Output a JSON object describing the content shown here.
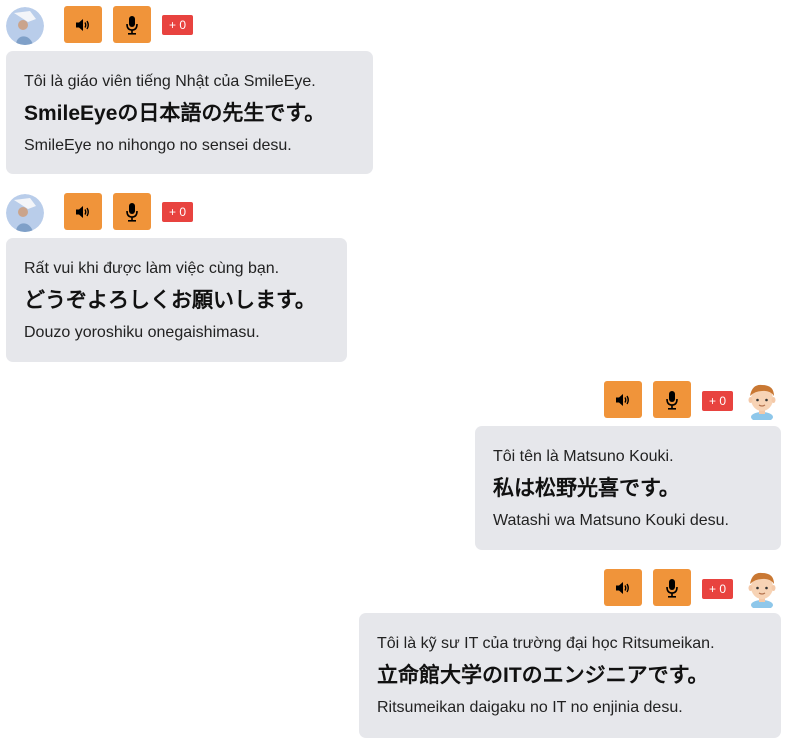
{
  "messages": [
    {
      "side": "left",
      "avatar": "teacher-avatar",
      "badge": "+ 0",
      "vi": "Tôi là giáo viên tiếng Nhật của SmileEye.",
      "ja": "SmileEyeの日本語の先生です。",
      "ro": "SmileEye no nihongo no sensei desu."
    },
    {
      "side": "left",
      "avatar": "teacher-avatar",
      "badge": "+ 0",
      "vi": "Rất vui khi được làm việc cùng bạn.",
      "ja": "どうぞよろしくお願いします。",
      "ro": "Douzo yoroshiku onegaishimasu."
    },
    {
      "side": "right",
      "avatar": "student-avatar",
      "badge": "+ 0",
      "vi": "Tôi tên là Matsuno Kouki.",
      "ja": "私は松野光喜です。",
      "ro": "Watashi wa Matsuno Kouki desu."
    },
    {
      "side": "right",
      "avatar": "student-avatar",
      "badge": "+ 0",
      "vi": "Tôi là kỹ sư IT của trường đại học Ritsumeikan.",
      "ja": "立命館大学のITのエンジニアです。",
      "ro": "Ritsumeikan daigaku no IT no enjinia desu."
    }
  ],
  "icons": {
    "speaker": "speaker-icon",
    "microphone": "microphone-icon"
  },
  "colors": {
    "button": "#f0943a",
    "badge": "#e8433f",
    "bubble": "#e6e7eb"
  }
}
